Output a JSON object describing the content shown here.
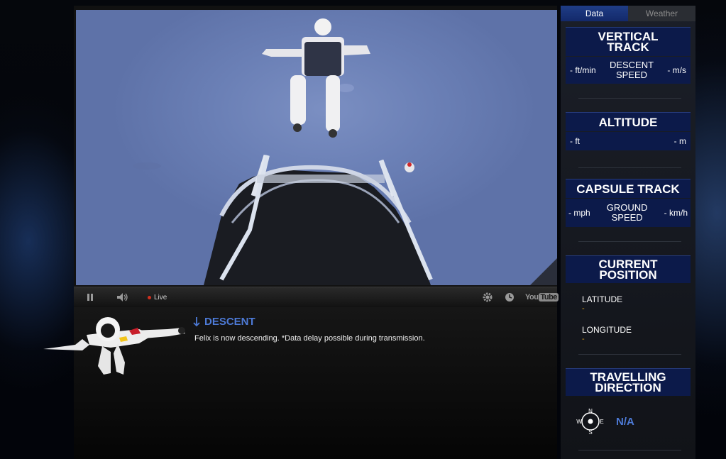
{
  "video": {
    "live_label": "Live",
    "brand": {
      "you": "You",
      "tube": "Tube"
    }
  },
  "status": {
    "title": "DESCENT",
    "message": "Felix is now descending. *Data delay possible during transmission."
  },
  "sidebar": {
    "tabs": [
      {
        "label": "Data",
        "active": true
      },
      {
        "label": "Weather",
        "active": false
      }
    ],
    "vertical_track": {
      "title_line1": "VERTICAL",
      "title_line2": "TRACK",
      "left": "- ft/min",
      "label_line1": "DESCENT",
      "label_line2": "SPEED",
      "right": "- m/s"
    },
    "altitude": {
      "title": "ALTITUDE",
      "left": "- ft",
      "right": "- m"
    },
    "capsule_track": {
      "title": "CAPSULE TRACK",
      "left": "- mph",
      "label_line1": "GROUND",
      "label_line2": "SPEED",
      "right": "- km/h"
    },
    "current_position": {
      "title_line1": "CURRENT",
      "title_line2": "POSITION",
      "latitude_label": "LATITUDE",
      "latitude_value": "-",
      "longitude_label": "LONGITUDE",
      "longitude_value": "-"
    },
    "travelling_direction": {
      "title_line1": "TRAVELLING",
      "title_line2": "DIRECTION",
      "compass": {
        "n": "N",
        "s": "S",
        "e": "E",
        "w": "W"
      },
      "value": "N/A"
    }
  },
  "colors": {
    "accent_blue": "#4d7ad6",
    "panel_navy": "#0c1a4a",
    "value_orange": "#d8a020",
    "live_red": "#d0301f"
  }
}
